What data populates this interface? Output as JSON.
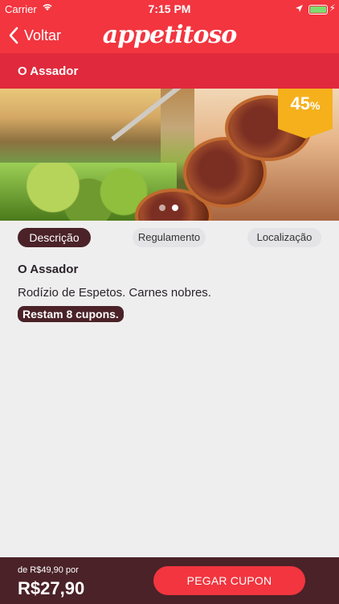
{
  "status_bar": {
    "carrier": "Carrier",
    "time": "7:15 PM"
  },
  "header": {
    "back_label": "Voltar",
    "brand": "appetitoso"
  },
  "restaurant": {
    "title": "O Assador",
    "discount_number": "45",
    "discount_suffix": "%",
    "carousel": {
      "count": 2,
      "active_index": 1
    }
  },
  "tabs": [
    {
      "label": "Descrição",
      "active": true
    },
    {
      "label": "Regulamento",
      "active": false
    },
    {
      "label": "Localização",
      "active": false
    }
  ],
  "content": {
    "name": "O Assador",
    "description": "Rodízio de Espetos. Carnes nobres.",
    "stock": "Restam 8 cupons."
  },
  "footer": {
    "from_price": "de R$49,90 por",
    "price": "R$27,90",
    "cta": "PEGAR CUPON"
  },
  "colors": {
    "header": "#f2353f",
    "title_bar": "#e0293c",
    "dark": "#4a2228",
    "badge": "#f5b01c",
    "background": "#efeeef"
  }
}
